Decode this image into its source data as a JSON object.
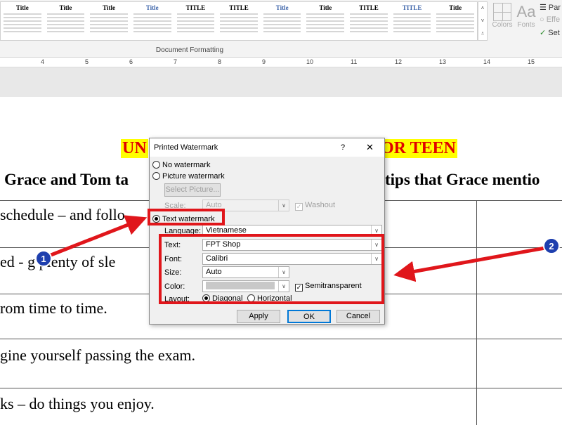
{
  "ribbon": {
    "styles": [
      "Title",
      "Title",
      "Title",
      "Title",
      "TITLE",
      "TITLE",
      "Title",
      "Title",
      "TITLE",
      "TITLE",
      "Title"
    ],
    "group_label": "Document Formatting",
    "colors_label": "Colors",
    "fonts_label": "Fonts",
    "paragraph_spacing": "Par",
    "effects": "Effe",
    "set_default": "Set"
  },
  "ruler": [
    "4",
    "5",
    "6",
    "7",
    "8",
    "9",
    "10",
    "11",
    "12",
    "13",
    "14",
    "15"
  ],
  "document": {
    "title_left": "UN",
    "title_right": "OR TEEN",
    "question_left": "Grace and Tom ta",
    "question_right": "tips that Grace mentio",
    "rows": [
      "schedule – and follo",
      "ed - g  plenty of sle",
      "rom time to time.",
      "gine yourself passing the exam.",
      "ks – do things you enjoy."
    ]
  },
  "dialog": {
    "title": "Printed Watermark",
    "help": "?",
    "close": "✕",
    "no_watermark": "No watermark",
    "picture_watermark": "Picture watermark",
    "select_picture": "Select Picture...",
    "scale_label": "Scale:",
    "scale_value": "Auto",
    "washout": "Washout",
    "text_watermark": "Text watermark",
    "language_label": "Language:",
    "language_value": "Vietnamese",
    "text_label": "Text:",
    "text_value": "FPT Shop",
    "font_label": "Font:",
    "font_value": "Calibri",
    "size_label": "Size:",
    "size_value": "Auto",
    "color_label": "Color:",
    "semitransparent": "Semitransparent",
    "layout_label": "Layout:",
    "diagonal": "Diagonal",
    "horizontal": "Horizontal",
    "apply": "Apply",
    "ok": "OK",
    "cancel": "Cancel",
    "selected_type": "Text watermark",
    "selected_layout": "Diagonal",
    "semitransparent_checked": true,
    "washout_checked": true
  },
  "annotations": {
    "marker1": "1",
    "marker2": "2",
    "red": "#e0161b",
    "marker_color": "#1e3fae"
  }
}
